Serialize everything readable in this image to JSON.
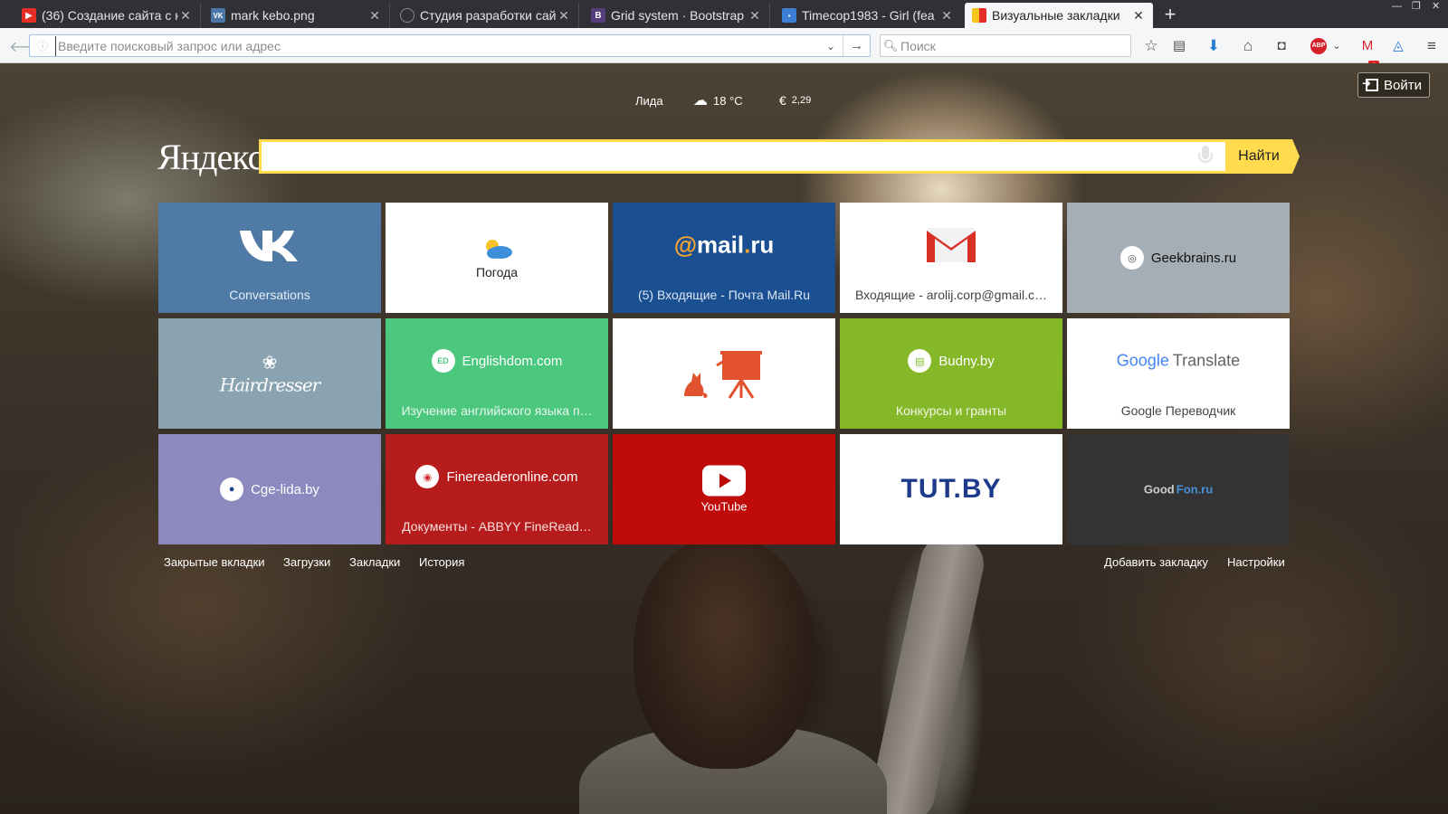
{
  "tabs": [
    {
      "title": "(36) Создание сайта с н",
      "icon": "youtube-icon",
      "color": "#e52d27",
      "glyph": "▶"
    },
    {
      "title": "mark kebo.png",
      "icon": "vk-icon",
      "color": "#4a76a8",
      "glyph": "VK"
    },
    {
      "title": "Студия разработки сай",
      "icon": "globe-icon",
      "color": "#6a6c70",
      "glyph": "◌"
    },
    {
      "title": "Grid system · Bootstrap",
      "icon": "bootstrap-icon",
      "color": "#563d7c",
      "glyph": "B"
    },
    {
      "title": "Timecop1983 - Girl (fea",
      "icon": "chat-icon",
      "color": "#3d7fd6",
      "glyph": "▪"
    },
    {
      "title": "Визуальные закладки",
      "icon": "yandex-bookmark-icon",
      "color": "#f5c518",
      "glyph": ""
    }
  ],
  "new_tab": "+",
  "nav": {
    "url_placeholder": "Введите поисковый запрос или адрес",
    "url_value": "",
    "search_placeholder": "Поиск",
    "mail_badge": "6"
  },
  "header": {
    "city": "Лида",
    "weather_temp": "18 °C",
    "currency_symbol": "€",
    "currency_value": "2,29",
    "login_label": "Войти"
  },
  "yandex": {
    "logo": "Яндекс",
    "search_value": "",
    "search_button": "Найти"
  },
  "tiles": [
    {
      "name": "Conversations",
      "caption": "Conversations",
      "bg": "#4f7aa5"
    },
    {
      "name": "Погода",
      "label": "Погода",
      "bg": "#ffffff"
    },
    {
      "name": "mail.ru",
      "logo": "@mail.ru",
      "caption": "(5) Входящие - Почта Mail.Ru",
      "bg": "#1a4f92"
    },
    {
      "name": "gmail",
      "caption": "Входящие - arolij.corp@gmail.c…",
      "bg": "#ffffff"
    },
    {
      "name": "Geekbrains.ru",
      "label": "Geekbrains.ru",
      "bg": "#a5adb5"
    },
    {
      "name": "hairdresser",
      "logo": "Hairdresser",
      "bg": "#8aa3b0"
    },
    {
      "name": "Englishdom.com",
      "label": "Englishdom.com",
      "caption": "Изучение английского языка п…",
      "bg": "#4bc77e"
    },
    {
      "name": "presentation",
      "bg": "#ffffff"
    },
    {
      "name": "Budny.by",
      "label": "Budny.by",
      "caption": "Конкурсы и гранты",
      "bg": "#84b829"
    },
    {
      "name": "Google Translate",
      "logo_google": "Google",
      "logo_translate": "Translate",
      "caption": "Google Переводчик",
      "bg": "#ffffff"
    },
    {
      "name": "Cge-lida.by",
      "label": "Cge-lida.by",
      "bg": "#8b89bd"
    },
    {
      "name": "Finereaderonline.com",
      "label": "Finereaderonline.com",
      "caption": "Документы - ABBYY FineRead…",
      "bg": "#b71c1c"
    },
    {
      "name": "YouTube",
      "label": "YouTube",
      "bg": "#c00b0b"
    },
    {
      "name": "TUT.BY",
      "logo": "TUT.BY",
      "bg": "#ffffff"
    },
    {
      "name": "GoodFon.ru",
      "logo_a": "Good",
      "logo_b": "Fon.ru",
      "bg": "#333333"
    }
  ],
  "footer": {
    "left": [
      "Закрытые вкладки",
      "Загрузки",
      "Закладки",
      "История"
    ],
    "right": [
      "Добавить закладку",
      "Настройки"
    ]
  }
}
